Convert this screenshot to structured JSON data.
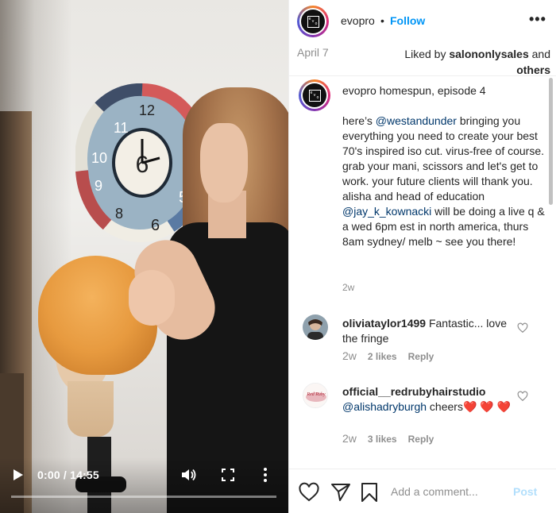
{
  "video": {
    "time_readout": "0:00 / 14:55",
    "progress": 0.0
  },
  "header": {
    "username": "evopro",
    "separator": "•",
    "follow_label": "Follow",
    "more_icon": "more-horizontal-icon"
  },
  "meta": {
    "date": "April 7",
    "liked_by_prefix": "Liked by ",
    "liked_by_user": "salononlysales",
    "liked_by_suffix_and": " and",
    "liked_by_others": "others"
  },
  "caption": {
    "username": "evopro",
    "title": "homespun, episode 4",
    "body_1": "here’s ",
    "mention_1": "@westandunder",
    "body_2": " bringing you everything you need to create your best 70's inspired iso cut. virus-free of course. grab your mani, scissors and let's get to work. your future clients will thank you. alisha and head of education ",
    "mention_2": "@jay_k_kownacki",
    "body_3": " will be doing a live q & a wed 6pm est in north america, thurs 8am sydney/ melb ~ see you there!",
    "age": "2w"
  },
  "comments": [
    {
      "username": "oliviataylor1499",
      "text": " Fantastic... love the fringe",
      "age": "2w",
      "likes": "2 likes",
      "reply": "Reply"
    },
    {
      "username": "official__redrubyhairstudio",
      "mention": "@alishadryburgh",
      "text": " cheers❤️ ❤️ ❤️",
      "age": "2w",
      "likes": "3 likes",
      "reply": "Reply",
      "avatar_text": "Red Ruby"
    }
  ],
  "actions": {
    "add_comment_placeholder": "Add a comment...",
    "post_label": "Post"
  },
  "colors": {
    "accent": "#0095f6",
    "post_disabled": "#b2dffc",
    "mention": "#00376b",
    "muted": "#8e8e8e"
  }
}
